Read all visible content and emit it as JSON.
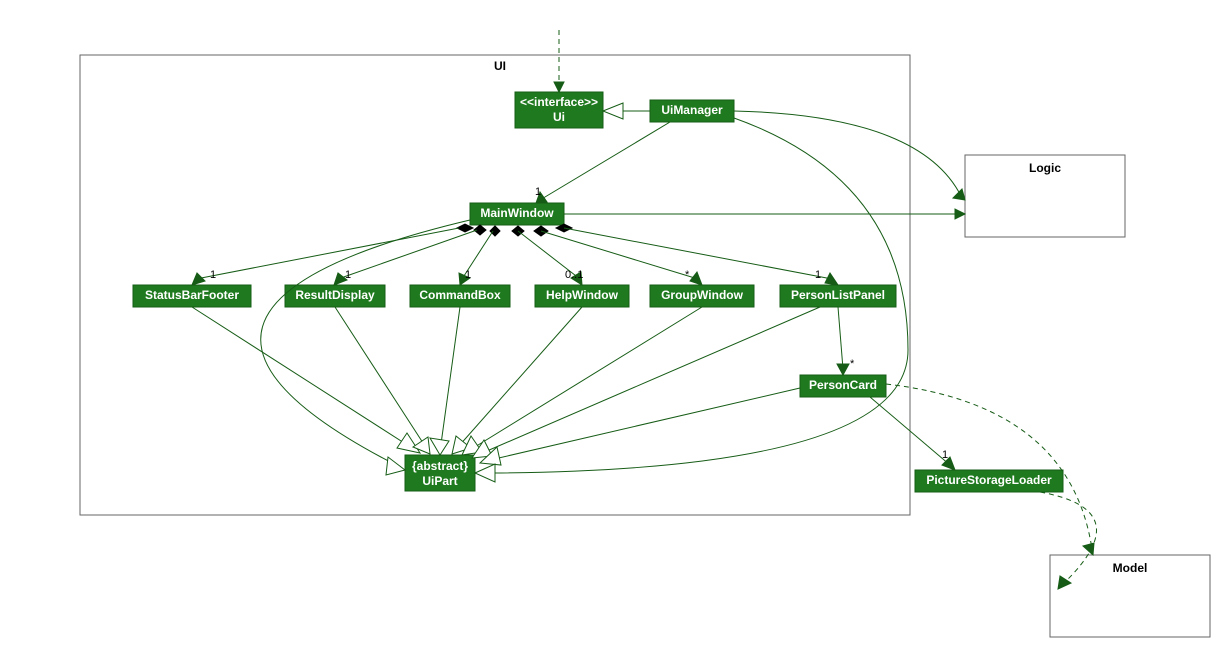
{
  "chart_data": {
    "type": "uml-class-diagram",
    "packages": [
      {
        "name": "UI"
      },
      {
        "name": "Logic"
      },
      {
        "name": "Model"
      }
    ],
    "classes": [
      {
        "id": "Ui",
        "stereotype": "<<interface>>",
        "name": "Ui"
      },
      {
        "id": "UiManager",
        "name": "UiManager"
      },
      {
        "id": "MainWindow",
        "name": "MainWindow"
      },
      {
        "id": "StatusBarFooter",
        "name": "StatusBarFooter"
      },
      {
        "id": "ResultDisplay",
        "name": "ResultDisplay"
      },
      {
        "id": "CommandBox",
        "name": "CommandBox"
      },
      {
        "id": "HelpWindow",
        "name": "HelpWindow"
      },
      {
        "id": "GroupWindow",
        "name": "GroupWindow"
      },
      {
        "id": "PersonListPanel",
        "name": "PersonListPanel"
      },
      {
        "id": "PersonCard",
        "name": "PersonCard"
      },
      {
        "id": "PictureStorageLoader",
        "name": "PictureStorageLoader"
      },
      {
        "id": "UiPart",
        "stereotype": "{abstract}",
        "name": "UiPart"
      }
    ],
    "relationships": [
      {
        "from": "(external)",
        "to": "Ui",
        "kind": "dependency"
      },
      {
        "from": "UiManager",
        "to": "Ui",
        "kind": "realization"
      },
      {
        "from": "UiManager",
        "to": "MainWindow",
        "kind": "association",
        "multiplicity": "1"
      },
      {
        "from": "UiManager",
        "to": "Logic",
        "kind": "association"
      },
      {
        "from": "MainWindow",
        "to": "Logic",
        "kind": "association"
      },
      {
        "from": "MainWindow",
        "to": "StatusBarFooter",
        "kind": "composition",
        "multiplicity": "1"
      },
      {
        "from": "MainWindow",
        "to": "ResultDisplay",
        "kind": "composition",
        "multiplicity": "1"
      },
      {
        "from": "MainWindow",
        "to": "CommandBox",
        "kind": "composition",
        "multiplicity": "1"
      },
      {
        "from": "MainWindow",
        "to": "HelpWindow",
        "kind": "composition",
        "multiplicity": "0..1"
      },
      {
        "from": "MainWindow",
        "to": "GroupWindow",
        "kind": "composition",
        "multiplicity": "*"
      },
      {
        "from": "MainWindow",
        "to": "PersonListPanel",
        "kind": "composition",
        "multiplicity": "1"
      },
      {
        "from": "PersonListPanel",
        "to": "PersonCard",
        "kind": "association",
        "multiplicity": "*"
      },
      {
        "from": "PersonCard",
        "to": "PictureStorageLoader",
        "kind": "association",
        "multiplicity": "1"
      },
      {
        "from": "MainWindow",
        "to": "UiPart",
        "kind": "generalization"
      },
      {
        "from": "StatusBarFooter",
        "to": "UiPart",
        "kind": "generalization"
      },
      {
        "from": "ResultDisplay",
        "to": "UiPart",
        "kind": "generalization"
      },
      {
        "from": "CommandBox",
        "to": "UiPart",
        "kind": "generalization"
      },
      {
        "from": "HelpWindow",
        "to": "UiPart",
        "kind": "generalization"
      },
      {
        "from": "GroupWindow",
        "to": "UiPart",
        "kind": "generalization"
      },
      {
        "from": "PersonListPanel",
        "to": "UiPart",
        "kind": "generalization"
      },
      {
        "from": "PersonCard",
        "to": "UiPart",
        "kind": "generalization"
      },
      {
        "from": "UiManager",
        "to": "UiPart",
        "kind": "generalization"
      },
      {
        "from": "PersonCard",
        "to": "Model",
        "kind": "dependency"
      },
      {
        "from": "PictureStorageLoader",
        "to": "Model",
        "kind": "dependency"
      }
    ]
  },
  "labels": {
    "pkg_ui": "UI",
    "pkg_logic": "Logic",
    "pkg_model": "Model",
    "ui_stereo": "<<interface>>",
    "ui_name": "Ui",
    "uimanager": "UiManager",
    "mainwindow": "MainWindow",
    "statusbar": "StatusBarFooter",
    "resultdisplay": "ResultDisplay",
    "commandbox": "CommandBox",
    "helpwindow": "HelpWindow",
    "groupwindow": "GroupWindow",
    "personlistpanel": "PersonListPanel",
    "personcard": "PersonCard",
    "picstore": "PictureStorageLoader",
    "uipart_stereo": "{abstract}",
    "uipart_name": "UiPart",
    "m1": "1",
    "m01": "0..1",
    "mstar": "*"
  }
}
